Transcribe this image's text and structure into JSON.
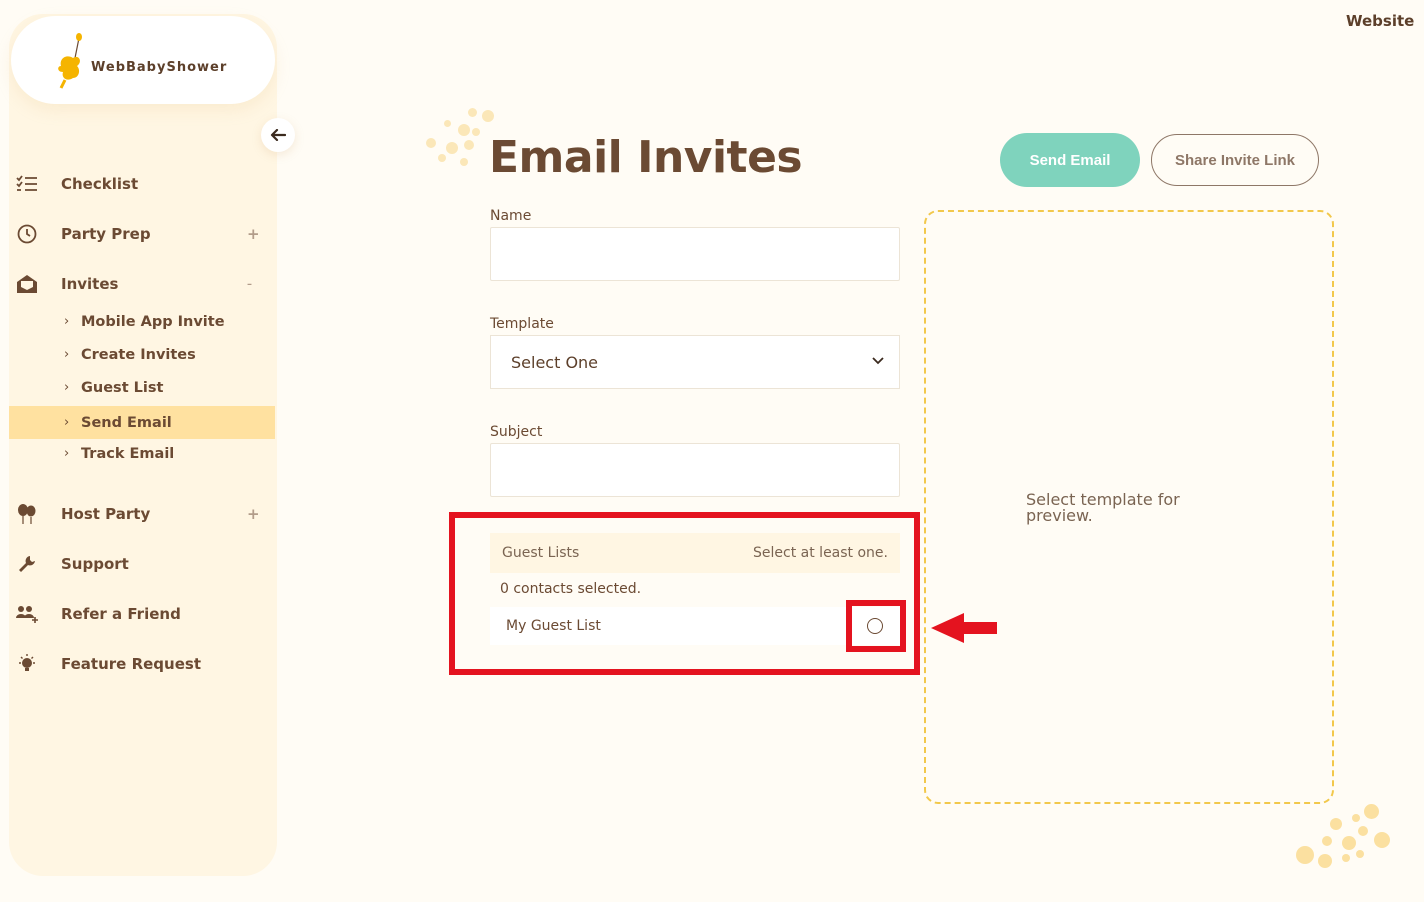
{
  "brand": {
    "name": "WebBabyShower"
  },
  "top_link": "Website",
  "sidebar": {
    "items": [
      {
        "label": "Checklist",
        "icon": "checklist-icon",
        "toggle": ""
      },
      {
        "label": "Party Prep",
        "icon": "history-icon",
        "toggle": "+"
      },
      {
        "label": "Invites",
        "icon": "envelope-open-icon",
        "toggle": "–"
      },
      {
        "label": "Host Party",
        "icon": "balloons-icon",
        "toggle": "+"
      },
      {
        "label": "Support",
        "icon": "wrench-icon",
        "toggle": ""
      },
      {
        "label": "Refer a Friend",
        "icon": "add-user-icon",
        "toggle": ""
      },
      {
        "label": "Feature Request",
        "icon": "lightbulb-icon",
        "toggle": ""
      }
    ],
    "invites_sub": [
      {
        "label": "Mobile App Invite",
        "active": false
      },
      {
        "label": "Create Invites",
        "active": false
      },
      {
        "label": "Guest List",
        "active": false
      },
      {
        "label": "Send Email",
        "active": true
      },
      {
        "label": "Track Email",
        "active": false
      }
    ]
  },
  "main": {
    "title": "Email Invites",
    "buttons": {
      "send": "Send Email",
      "share": "Share Invite Link"
    },
    "form": {
      "name_label": "Name",
      "name_value": "",
      "template_label": "Template",
      "template_value": "Select One",
      "subject_label": "Subject",
      "subject_value": ""
    },
    "guest_lists": {
      "title": "Guest Lists",
      "hint": "Select at least one.",
      "count_text": "0 contacts selected.",
      "items": [
        {
          "label": "My Guest List",
          "selected": false
        }
      ]
    },
    "preview": {
      "text": "Select template for preview."
    }
  },
  "colors": {
    "accent_teal": "#7fd3bd",
    "brand_brown": "#6b4a33",
    "highlight": "#ffe1a0",
    "annotation_red": "#e4131f",
    "dashed_border": "#f2c84b"
  }
}
